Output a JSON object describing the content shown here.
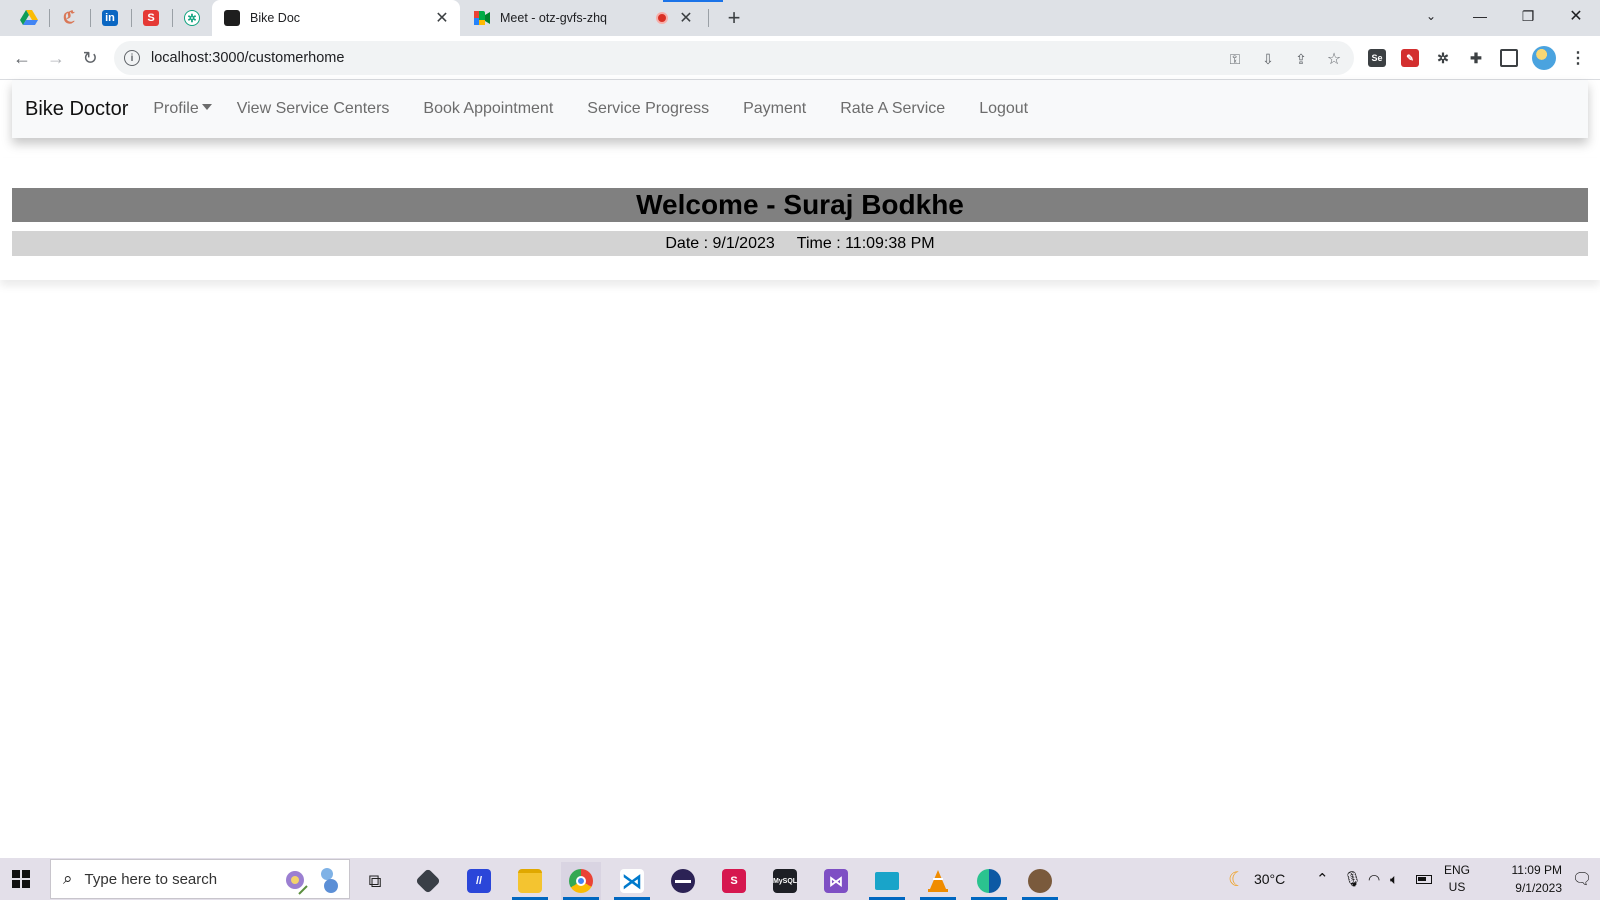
{
  "browser": {
    "tabs": [
      {
        "title": "Bike Doc",
        "active": true
      },
      {
        "title": "Meet - otz-gvfs-zhq",
        "active": false,
        "recording": true
      }
    ],
    "pinned_tabs": [
      "google-drive",
      "claude",
      "linkedin",
      "s-app",
      "chatgpt"
    ],
    "url": "localhost:3000/customerhome"
  },
  "navbar": {
    "brand": "Bike Doctor",
    "links": [
      "Profile",
      "View Service Centers",
      "Book Appointment",
      "Service Progress",
      "Payment",
      "Rate A Service",
      "Logout"
    ]
  },
  "welcome": {
    "heading": "Welcome - Suraj Bodkhe",
    "date": "Date : 9/1/2023",
    "time": "Time : 11:09:38 PM"
  },
  "taskbar": {
    "search_placeholder": "Type here to search",
    "weather": "30°C",
    "lang": "ENG",
    "region": "US",
    "clock_time": "11:09 PM",
    "clock_date": "9/1/2023"
  },
  "colors": {
    "welcome_bg": "#808080",
    "datetime_bg": "#d3d3d3",
    "navbar_bg": "#f8f9fa",
    "taskbar_bg": "#e3dfe9"
  }
}
